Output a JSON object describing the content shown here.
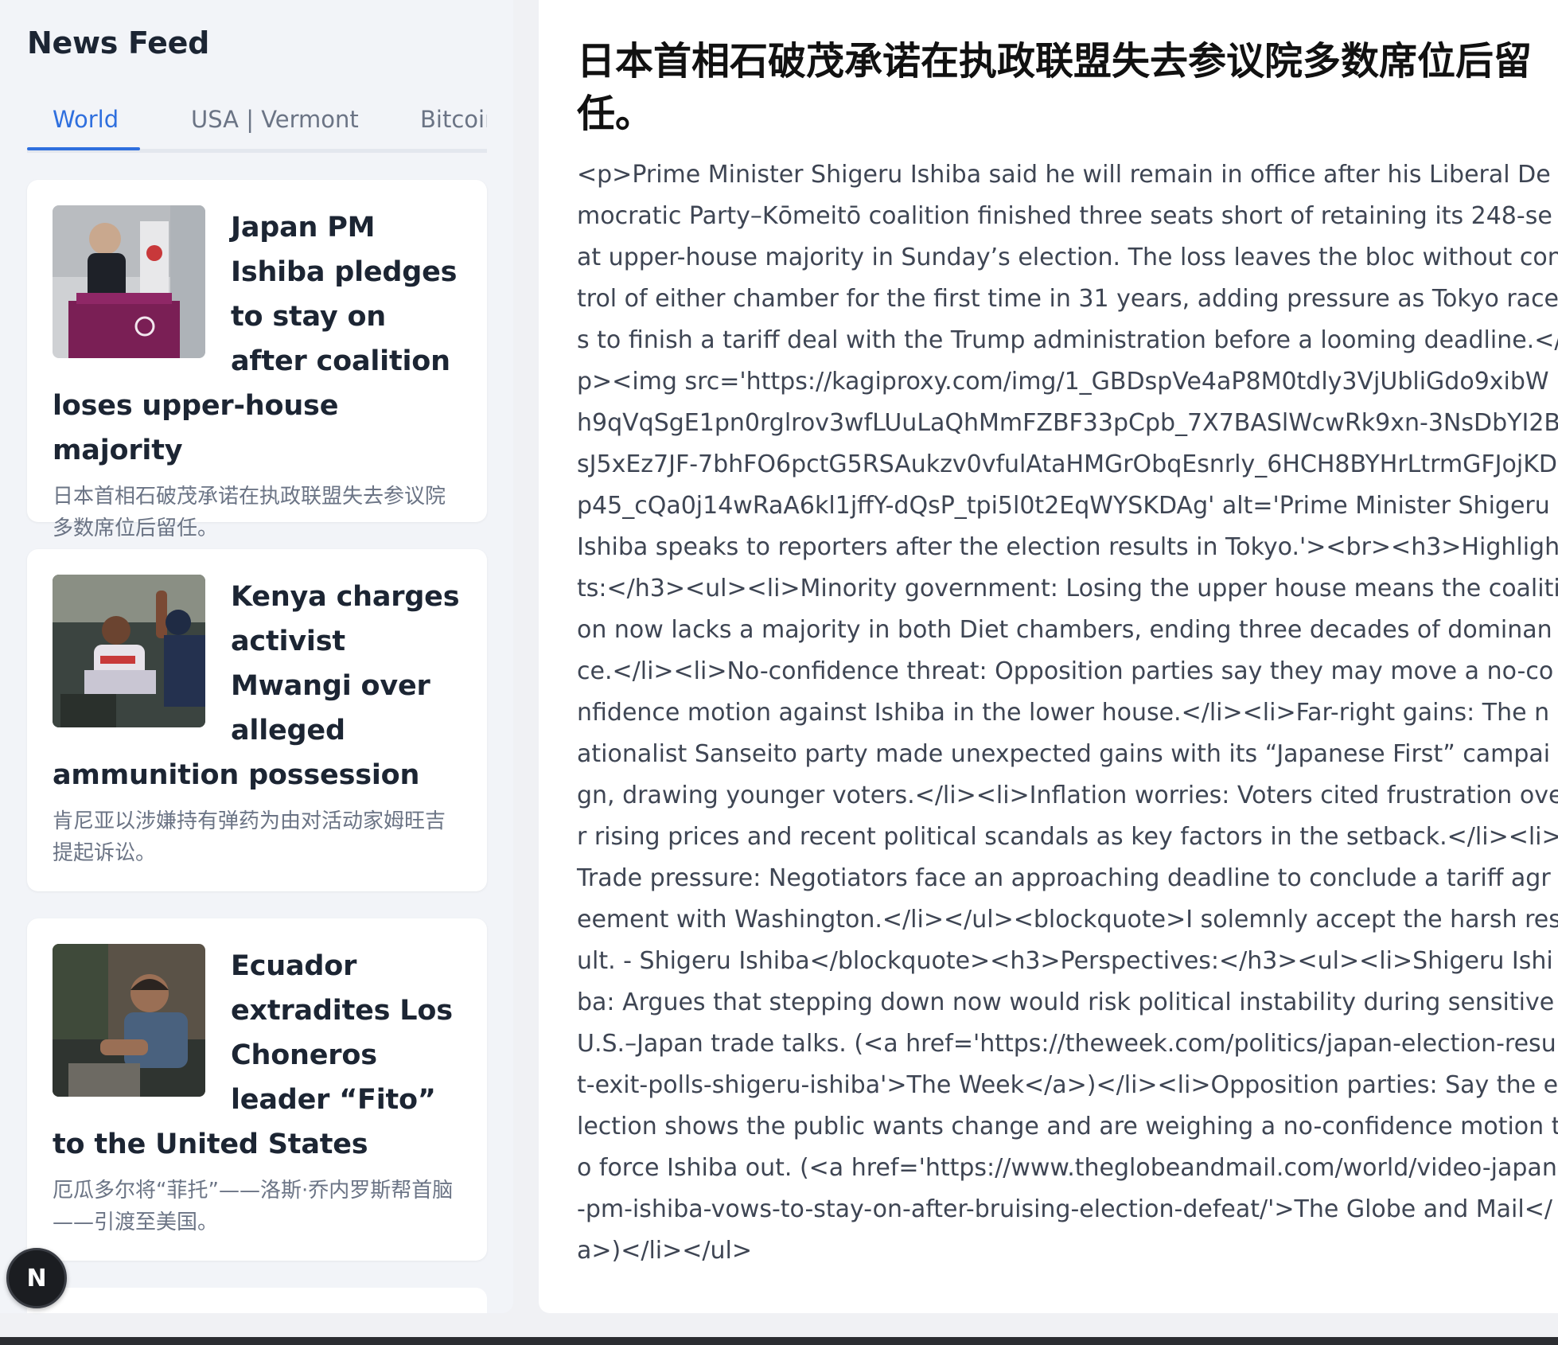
{
  "sidebar": {
    "title": "News Feed",
    "tabs": [
      {
        "label": "World",
        "active": true
      },
      {
        "label": "USA | Vermont",
        "active": false
      },
      {
        "label": "Bitcoin",
        "active": false
      }
    ],
    "cards": [
      {
        "headline": "Japan PM Ishiba pledges to stay on after coalition loses upper-house majority",
        "summary": "日本首相石破茂承诺在执政联盟失去参议院多数席位后留任。",
        "thumb_icon": "podium-photo"
      },
      {
        "headline": "Kenya charges activist Mwangi over alleged ammunition possession",
        "summary": "肯尼亚以涉嫌持有弹药为由对活动家姆旺吉提起诉讼。",
        "thumb_icon": "activist-photo"
      },
      {
        "headline": "Ecuador extradites Los Choneros leader “Fito” to the United States",
        "summary": "厄瓜多尔将“菲托”——洛斯·乔内罗斯帮首脑——引渡至美国。",
        "thumb_icon": "detainee-photo"
      }
    ]
  },
  "fab": {
    "label": "N"
  },
  "article": {
    "title": "日本首相石破茂承诺在执政联盟失去参议院多数席位后留任。",
    "body": "<p>Prime Minister Shigeru Ishiba said he will remain in office after his Liberal Democratic Party–Kōmeitō coalition finished three seats short of retaining its 248-seat upper-house majority in Sunday’s election. The loss leaves the bloc without control of either chamber for the first time in 31 years, adding pressure as Tokyo races to finish a tariff deal with the Trump administration before a looming deadline.</p><img src='https://kagiproxy.com/img/1_GBDspVe4aP8M0tdly3VjUbliGdo9xibWh9qVqSgE1pn0rglrov3wfLUuLaQhMmFZBF33pCpb_7X7BASlWcwRk9xn-3NsDbYI2BsJ5xEz7JF-7bhFO6pctG5RSAukzv0vfulAtaHMGrObqEsnrly_6HCH8BYHrLtrmGFJojKDp45_cQa0j14wRaA6kl1jffY-dQsP_tpi5l0t2EqWYSKDAg' alt='Prime Minister Shigeru Ishiba speaks to reporters after the election results in Tokyo.'><br><h3>Highlights:</h3><ul><li>Minority government: Losing the upper house means the coalition now lacks a majority in both Diet chambers, ending three decades of dominance.</li><li>No-confidence threat: Opposition parties say they may move a no-confidence motion against Ishiba in the lower house.</li><li>Far-right gains: The nationalist Sanseito party made unexpected gains with its “Japanese First” campaign, drawing younger voters.</li><li>Inflation worries: Voters cited frustration over rising prices and recent political scandals as key factors in the setback.</li><li>Trade pressure: Negotiators face an approaching deadline to conclude a tariff agreement with Washington.</li></ul><blockquote>I solemnly accept the harsh result. - Shigeru Ishiba</blockquote><h3>Perspectives:</h3><ul><li>Shigeru Ishiba: Argues that stepping down now would risk political instability during sensitive U.S.–Japan trade talks. (<a href='https://theweek.com/politics/japan-election-result-exit-polls-shigeru-ishiba'>The Week</a>)</li><li>Opposition parties: Say the election shows the public wants change and are weighing a no-confidence motion to force Ishiba out. (<a href='https://www.theglobeandmail.com/world/video-japan-pm-ishiba-vows-to-stay-on-after-bruising-election-defeat/'>The Globe and Mail</a>)</li></ul>"
  },
  "colors": {
    "accent": "#2f6fde",
    "sidebar_bg": "#f2f4f8",
    "card_bg": "#ffffff",
    "heading": "#1c2533",
    "muted": "#6b7485"
  }
}
